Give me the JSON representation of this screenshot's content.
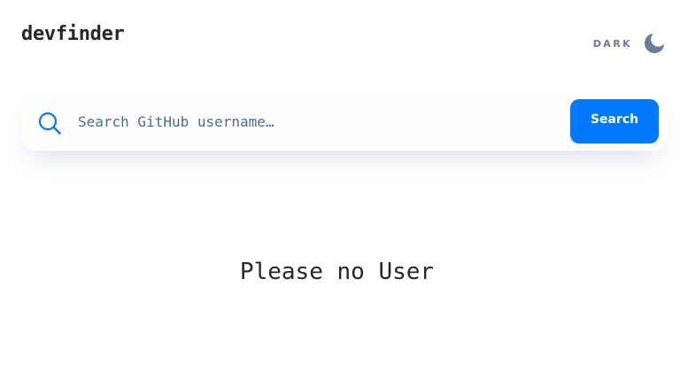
{
  "header": {
    "logo": "devfinder",
    "theme_toggle": {
      "label": "DARK",
      "icon": "moon-icon"
    }
  },
  "search": {
    "icon": "search-icon",
    "placeholder": "Search GitHub username…",
    "value": "",
    "button_label": "Search"
  },
  "main": {
    "message": "Please no User"
  },
  "colors": {
    "accent": "#0079ff",
    "text": "#222731",
    "muted": "#697c9a",
    "input_text": "#4b6a9b",
    "background": "#ffffff",
    "card": "#fefefe"
  }
}
